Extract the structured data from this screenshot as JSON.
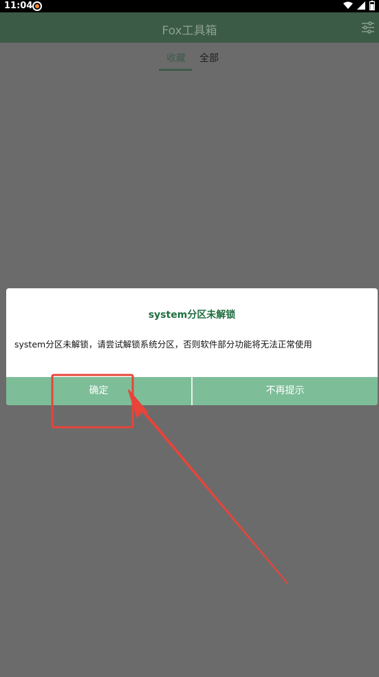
{
  "status_bar": {
    "time": "11:04",
    "icons": [
      "sync-icon",
      "wifi-icon",
      "cellular-icon",
      "battery-icon"
    ]
  },
  "app_bar": {
    "title": "Fox工具箱",
    "actions": [
      "filter-settings-icon"
    ]
  },
  "tabs": [
    {
      "label": "收藏",
      "selected": true
    },
    {
      "label": "全部",
      "selected": false
    }
  ],
  "dialog": {
    "title": "system分区未解锁",
    "message": "system分区未解锁，请尝试解锁系统分区，否则软件部分功能将无法正常使用",
    "buttons": {
      "confirm": "确定",
      "no_remind": "不再提示"
    }
  },
  "colors": {
    "app_bar": "#3c5b46",
    "dialog_title": "#1f6e3f",
    "button_bar": "#7dbd98",
    "annotation": "#e8443a",
    "overlay_background": "#6b6b6b"
  },
  "annotation": {
    "shapes": [
      "highlight-box",
      "arrow"
    ],
    "target": "确定"
  }
}
